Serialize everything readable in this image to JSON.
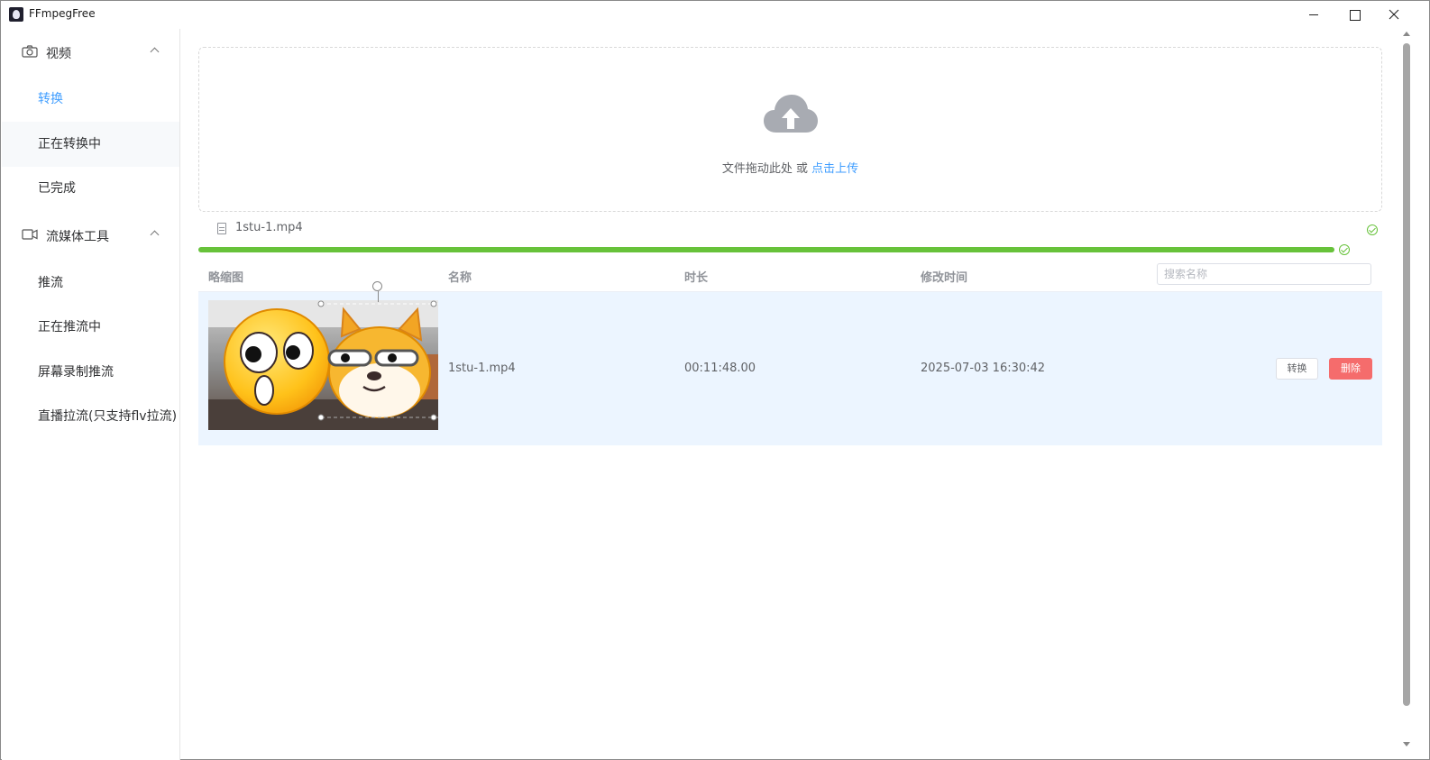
{
  "window": {
    "title": "FFmpegFree"
  },
  "sidebar": {
    "groups": [
      {
        "label": "视频",
        "items": [
          {
            "label": "转换",
            "active": true
          },
          {
            "label": "正在转换中"
          },
          {
            "label": "已完成"
          }
        ]
      },
      {
        "label": "流媒体工具",
        "items": [
          {
            "label": "推流"
          },
          {
            "label": "正在推流中"
          },
          {
            "label": "屏幕录制推流"
          },
          {
            "label": "直播拉流(只支持flv拉流)"
          }
        ]
      }
    ]
  },
  "upload": {
    "hint": "文件拖动此处 或 ",
    "link": "点击上传",
    "file_name": "1stu-1.mp4",
    "progress": 1.0
  },
  "table": {
    "headers": {
      "thumbnail": "略缩图",
      "name": "名称",
      "duration": "时长",
      "modified": "修改时间"
    },
    "search_placeholder": "搜索名称",
    "rows": [
      {
        "name": "1stu-1.mp4",
        "duration": "00:11:48.00",
        "modified": "2025-07-03 16:30:42",
        "convert": "转换",
        "delete": "删除"
      }
    ]
  },
  "colors": {
    "accent": "#409eff",
    "success": "#67c23a",
    "danger": "#f56c6c",
    "row_highlight": "#ecf5ff"
  }
}
